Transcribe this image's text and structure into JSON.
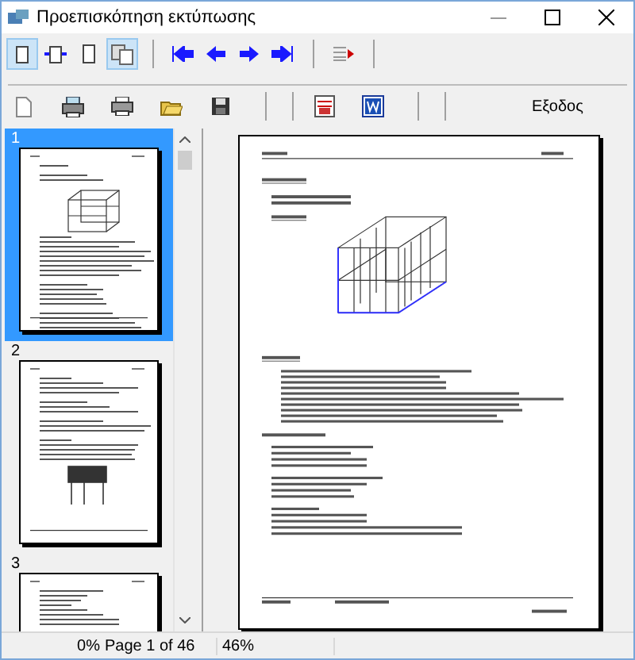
{
  "window": {
    "title": "Προεπισκόπηση εκτύπωσης"
  },
  "toolbar_1": [
    {
      "kind": "single-page",
      "selected": true
    },
    {
      "kind": "page-width",
      "selected": false
    },
    {
      "kind": "full-page",
      "selected": false
    },
    {
      "kind": "two-pages",
      "selected": true
    },
    {
      "kind": "separator"
    },
    {
      "kind": "first",
      "selected": false
    },
    {
      "kind": "previous",
      "selected": false
    },
    {
      "kind": "next",
      "selected": false
    },
    {
      "kind": "last",
      "selected": false
    },
    {
      "kind": "separator"
    },
    {
      "kind": "goto",
      "selected": false
    },
    {
      "kind": "separator"
    }
  ],
  "toolbar_2": [
    {
      "kind": "blank-page"
    },
    {
      "kind": "printer-setup"
    },
    {
      "kind": "printer"
    },
    {
      "kind": "open"
    },
    {
      "kind": "save"
    },
    {
      "kind": "separator"
    },
    {
      "kind": "separator"
    },
    {
      "kind": "pdf"
    },
    {
      "kind": "word"
    },
    {
      "kind": "separator"
    },
    {
      "kind": "separator"
    },
    {
      "kind": "text",
      "label": "Εξοδος"
    }
  ],
  "thumbnails": [
    {
      "label": "1",
      "selected": true
    },
    {
      "label": "2",
      "selected": false
    },
    {
      "label": "3",
      "selected": false
    }
  ],
  "status_bar": {
    "progress": "0%",
    "page": "Page 1 of 46",
    "zoom": "46%"
  }
}
